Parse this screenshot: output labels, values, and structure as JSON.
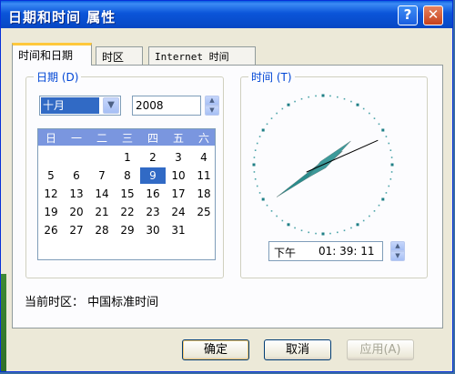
{
  "window": {
    "title": "日期和时间 属性",
    "help_label": "?",
    "close_label": "✕"
  },
  "tabs": [
    {
      "label": "时间和日期",
      "active": true
    },
    {
      "label": "时区",
      "active": false
    },
    {
      "label": "Internet 时间",
      "active": false
    }
  ],
  "date_group": {
    "label": "日期 (D)",
    "month": "十月",
    "month_arrow": "▼",
    "year": "2008",
    "weekdays": [
      "日",
      "一",
      "二",
      "三",
      "四",
      "五",
      "六"
    ],
    "days": [
      "",
      "",
      "",
      "1",
      "2",
      "3",
      "4",
      "5",
      "6",
      "7",
      "8",
      "9",
      "10",
      "11",
      "12",
      "13",
      "14",
      "15",
      "16",
      "17",
      "18",
      "19",
      "20",
      "21",
      "22",
      "23",
      "24",
      "25",
      "26",
      "27",
      "28",
      "29",
      "30",
      "31",
      ""
    ],
    "selected_day": "9"
  },
  "time_group": {
    "label": "时间 (T)",
    "ampm": "下午",
    "time": "01: 39: 11",
    "clock": {
      "hour": 1,
      "minute": 39,
      "second": 11
    }
  },
  "spin_up": "▲",
  "spin_down": "▼",
  "timezone": {
    "label": "当前时区：",
    "value": "中国标准时间"
  },
  "buttons": {
    "ok": "确定",
    "cancel": "取消",
    "apply": "应用(A)"
  },
  "colors": {
    "title_bar": "#0b55d9",
    "accent_tab": "#ffc83c",
    "selection": "#316ac5",
    "clock_hands": "#2a8c8c"
  }
}
